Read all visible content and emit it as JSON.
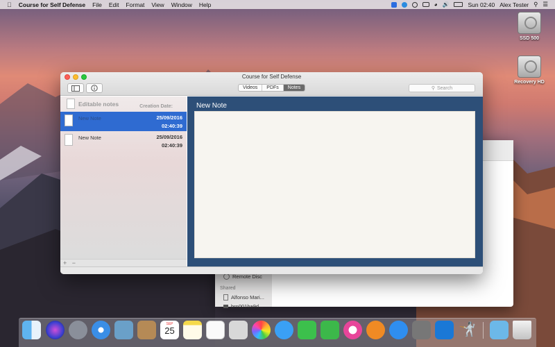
{
  "menubar": {
    "app_name": "Course for Self Defense",
    "menus": [
      "File",
      "Edit",
      "Format",
      "View",
      "Window",
      "Help"
    ],
    "clock": "Sun 02:40",
    "user": "Alex Tester"
  },
  "desktop": {
    "icons": [
      {
        "label": "SSD 500"
      },
      {
        "label": "Recovery HD"
      }
    ]
  },
  "back_window": {
    "items": [
      "Remote Disc",
      "Shared",
      "Alfonso Mari...",
      "brn001ba9d..."
    ]
  },
  "window": {
    "title": "Course for Self Defense",
    "tabs": [
      {
        "label": "Videos",
        "active": false
      },
      {
        "label": "PDFs",
        "active": false
      },
      {
        "label": "Notes",
        "active": true
      }
    ],
    "search_placeholder": "Search",
    "sidebar": {
      "title": "Editable notes",
      "date_header": "Creation Date:",
      "notes": [
        {
          "name": "New Note",
          "date": "25/09/2016",
          "time": "02:40:39",
          "selected": true
        },
        {
          "name": "New Note",
          "date": "25/09/2016",
          "time": "02:40:39",
          "selected": false
        }
      ],
      "footer_add": "+",
      "footer_remove": "−"
    },
    "editor": {
      "note_title": "New Note"
    }
  },
  "dock": {
    "apps": [
      "finder-icon",
      "siri-icon",
      "launchpad-icon",
      "safari-icon",
      "preview-icon",
      "contacts-icon",
      "calendar-icon",
      "notes-icon",
      "reminders-icon",
      "photo-booth-icon",
      "photos-icon",
      "messages-icon",
      "facetime-icon",
      "numbers-icon",
      "itunes-icon",
      "ibooks-icon",
      "app-store-icon",
      "system-preferences-icon",
      "teamviewer-icon",
      "self-defense-icon",
      "downloads-icon",
      "trash-icon"
    ],
    "calendar_month": "SEP",
    "calendar_day": "25"
  },
  "colors": {
    "selection": "#2f6bd1",
    "editor_bg": "#2d4f78",
    "paper": "#f7f5f0"
  }
}
